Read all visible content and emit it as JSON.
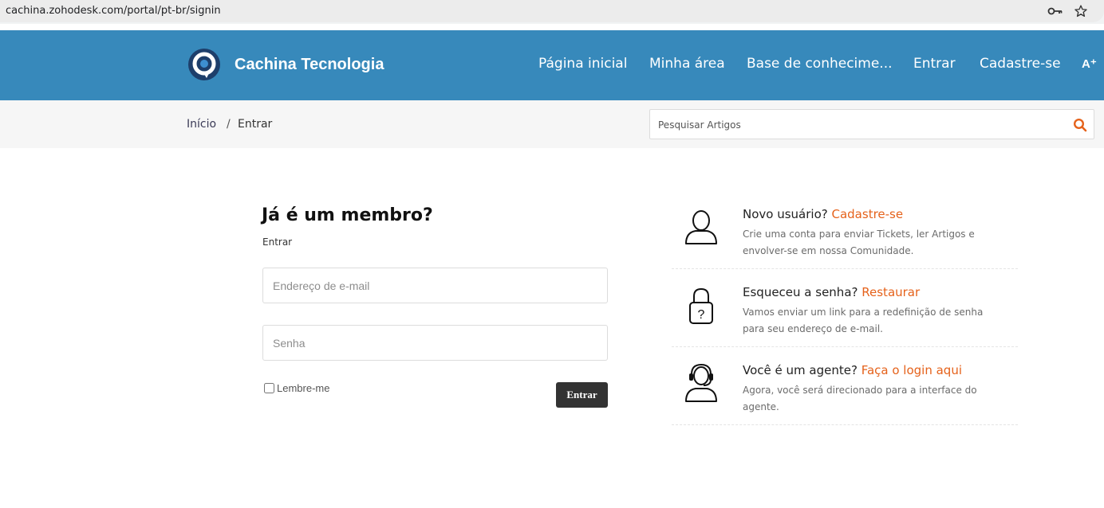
{
  "browser": {
    "url": "cachina.zohodesk.com/portal/pt-br/signin"
  },
  "header": {
    "brand": "Cachina Tecnologia",
    "nav": [
      "Página inicial",
      "Minha área",
      "Base de conhecime...",
      "Entrar",
      "Cadastre-se"
    ],
    "a11y_label": "A⁺"
  },
  "breadcrumb": {
    "home": "Início",
    "separator": "/",
    "current": "Entrar"
  },
  "search": {
    "placeholder": "Pesquisar Artigos"
  },
  "login": {
    "title": "Já é um membro?",
    "subtitle": "Entrar",
    "email_placeholder": "Endereço de e-mail",
    "password_placeholder": "Senha",
    "remember_label": "Lembre-me",
    "submit_label": "Entrar"
  },
  "info": [
    {
      "icon": "user-icon",
      "question": "Novo usuário?",
      "link": "Cadastre-se",
      "desc": "Crie uma conta para enviar Tickets, ler Artigos e envolver-se em nossa Comunidade."
    },
    {
      "icon": "lock-icon",
      "question": "Esqueceu a senha?",
      "link": "Restaurar",
      "desc": "Vamos enviar um link para a redefinição de senha para seu endereço de e-mail."
    },
    {
      "icon": "headset-agent-icon",
      "question": "Você é um agente?",
      "link": "Faça o login aqui",
      "desc": "Agora, você será direcionado para a interface do agente."
    }
  ],
  "colors": {
    "header_bg": "#3789bb",
    "accent_link": "#e5621b",
    "button_bg": "#333333"
  }
}
